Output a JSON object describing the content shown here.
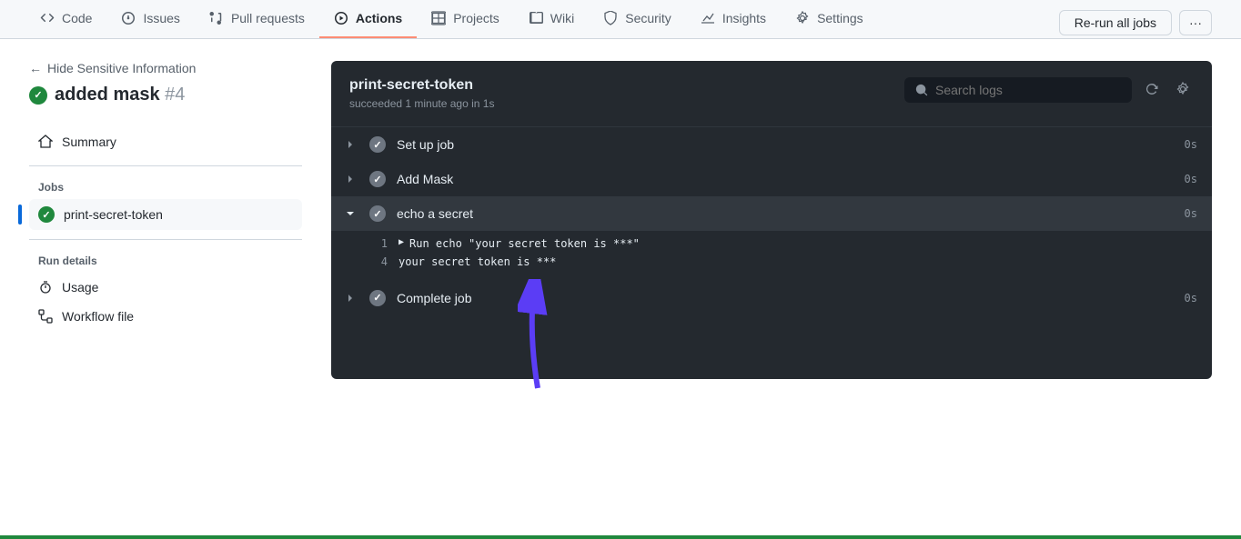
{
  "nav": {
    "tabs": [
      {
        "label": "Code",
        "icon": "code"
      },
      {
        "label": "Issues",
        "icon": "issue"
      },
      {
        "label": "Pull requests",
        "icon": "pr"
      },
      {
        "label": "Actions",
        "icon": "play",
        "active": true
      },
      {
        "label": "Projects",
        "icon": "project"
      },
      {
        "label": "Wiki",
        "icon": "book"
      },
      {
        "label": "Security",
        "icon": "shield"
      },
      {
        "label": "Insights",
        "icon": "graph"
      },
      {
        "label": "Settings",
        "icon": "gear"
      }
    ]
  },
  "back_link": "Hide Sensitive Information",
  "run": {
    "title": "added mask",
    "number": "#4"
  },
  "buttons": {
    "rerun": "Re-run all jobs"
  },
  "sidebar": {
    "summary": "Summary",
    "jobs_heading": "Jobs",
    "job_label": "print-secret-token",
    "details_heading": "Run details",
    "usage": "Usage",
    "workflow_file": "Workflow file"
  },
  "job": {
    "name": "print-secret-token",
    "status_line": "succeeded 1 minute ago in 1s",
    "search_placeholder": "Search logs"
  },
  "steps": [
    {
      "name": "Set up job",
      "time": "0s",
      "expanded": false
    },
    {
      "name": "Add Mask",
      "time": "0s",
      "expanded": false
    },
    {
      "name": "echo a secret",
      "time": "0s",
      "expanded": true
    },
    {
      "name": "Complete job",
      "time": "0s",
      "expanded": false
    }
  ],
  "log_lines": [
    {
      "n": "1",
      "text": "Run echo \"your secret token is ***\"",
      "caret": true
    },
    {
      "n": "4",
      "text": "your secret token is ***",
      "caret": false
    }
  ]
}
